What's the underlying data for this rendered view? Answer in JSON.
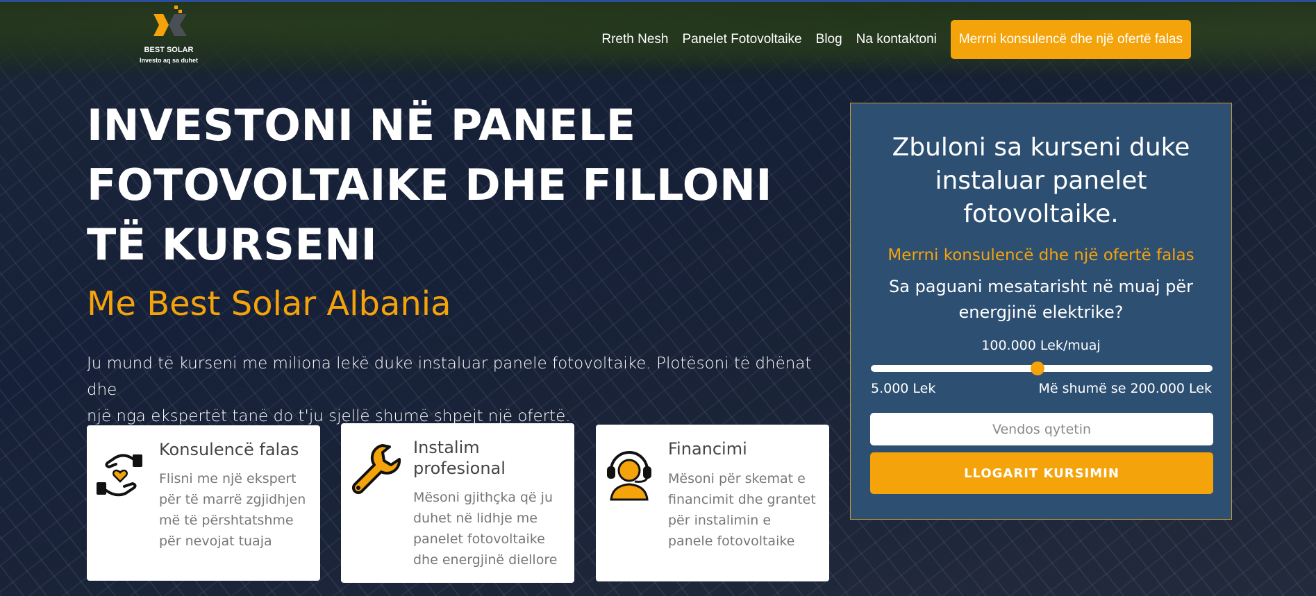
{
  "brand": {
    "name": "BEST SOLAR",
    "tagline": "Investo aq sa duhet",
    "colors": {
      "accent": "#f5a30b",
      "panel": "#2d4f72",
      "logo_dark": "#4a4f57"
    }
  },
  "nav": {
    "items": [
      {
        "label": "Rreth Nesh"
      },
      {
        "label": "Panelet Fotovoltaike"
      },
      {
        "label": "Blog"
      },
      {
        "label": "Na kontaktoni"
      }
    ],
    "cta_label": "Merrni konsulencë dhe një ofertë falas"
  },
  "hero": {
    "headline_lines": [
      "INVESTONI NË PANELE",
      "FOTOVOLTAIKE DHE FILLONI",
      "TË KURSENI"
    ],
    "subheadline": "Me Best Solar Albania",
    "lead_lines": [
      "Ju mund të kurseni me miliona lekë duke instaluar panele fotovoltaike. Plotësoni të dhënat dhe",
      "një nga ekspertët tanë do t'ju sjellë shumë shpejt një ofertë."
    ]
  },
  "features": [
    {
      "icon": "handshake-heart-icon",
      "title_lines": [
        "Konsulencë falas"
      ],
      "text_lines": [
        "Flisni me një ekspert",
        "për të marrë zgjidhjen",
        "më të përshtatshme",
        "për nevojat tuaja"
      ]
    },
    {
      "icon": "wrench-icon",
      "title_lines": [
        "Instalim",
        "profesional"
      ],
      "text_lines": [
        "Mësoni gjithçka që ju",
        "duhet në lidhje me",
        "panelet fotovoltaike",
        "dhe energjinë diellore"
      ]
    },
    {
      "icon": "headset-support-icon",
      "title_lines": [
        "Financimi"
      ],
      "text_lines": [
        "Mësoni për skemat e",
        "financimit dhe grantet",
        "për instalimin e",
        "panele fotovoltaike"
      ]
    }
  ],
  "calculator": {
    "title_lines": [
      "Zbuloni sa kurseni duke",
      "instaluar panelet",
      "fotovoltaike."
    ],
    "offer": "Merrni konsulencë dhe një ofertë falas",
    "question_lines": [
      "Sa paguani mesatarisht në muaj për",
      "energjinë elektrike?"
    ],
    "current_value": "100.000 Lek/muaj",
    "slider_fraction": 0.487,
    "range_min": "5.000 Lek",
    "range_max": "Më shumë se 200.000 Lek",
    "city_placeholder": "Vendos qytetin",
    "button_label": "LLOGARIT KURSIMIN"
  }
}
